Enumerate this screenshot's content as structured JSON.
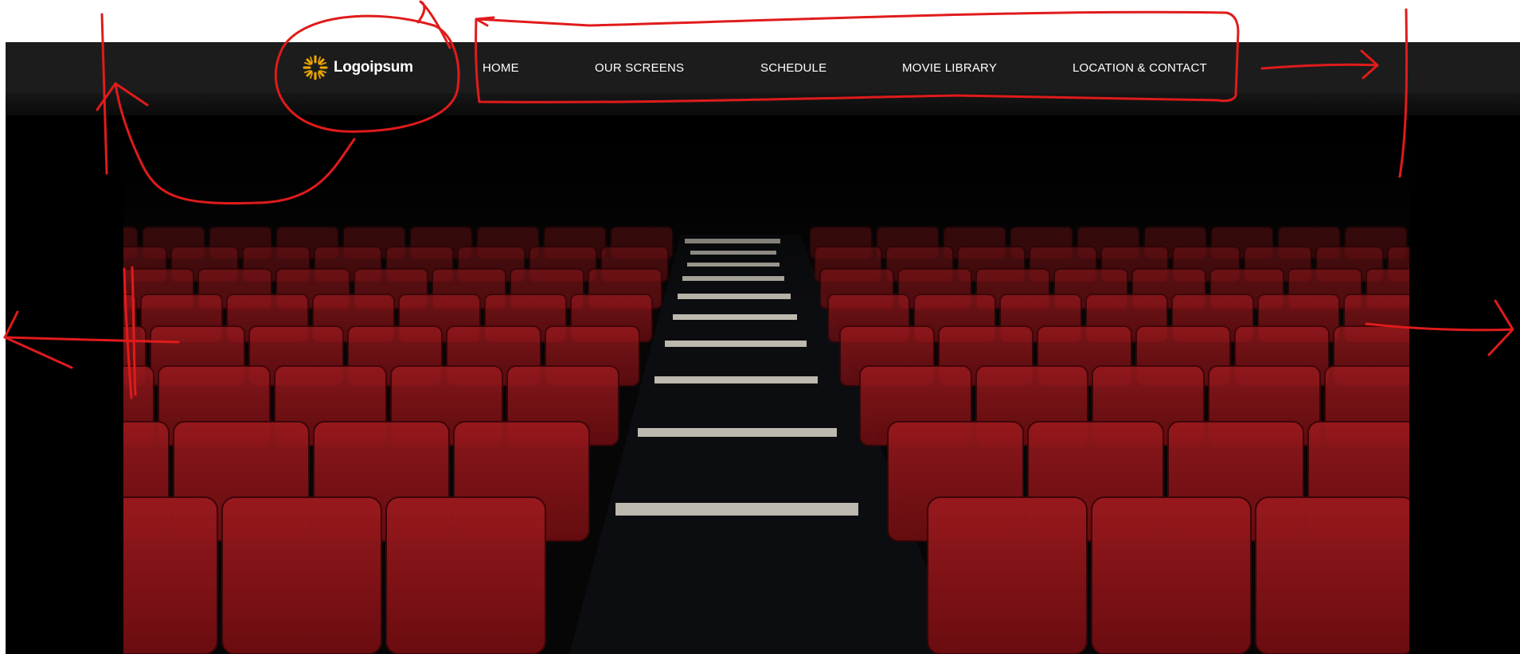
{
  "site": {
    "logo_text": "Logoipsum",
    "logo_icon": "sunburst-logo-icon",
    "nav": [
      {
        "label": "HOME"
      },
      {
        "label": "OUR SCREENS"
      },
      {
        "label": "SCHEDULE"
      },
      {
        "label": "MOVIE LIBRARY"
      },
      {
        "label": "LOCATION & CONTACT"
      }
    ]
  },
  "hero": {
    "image": "cinema-seats-photo"
  },
  "colors": {
    "navbar_bg": "#1c1c1c",
    "page_bg": "#000000",
    "seat_red": "#8e1418",
    "logo_gold": "#f2a900",
    "annotation_red": "#e01b1b"
  }
}
